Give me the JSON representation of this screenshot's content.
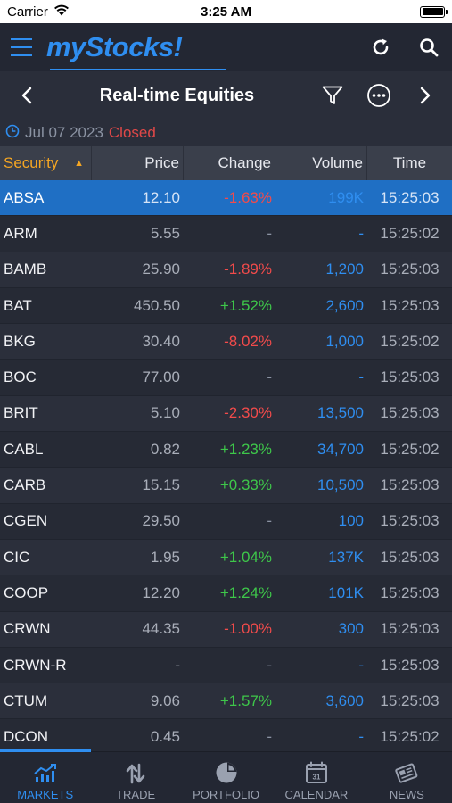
{
  "status": {
    "carrier": "Carrier",
    "time": "3:25 AM"
  },
  "app": {
    "logo": "myStocks!"
  },
  "header": {
    "title": "Real-time Equities"
  },
  "market": {
    "date": "Jul 07 2023",
    "state": "Closed"
  },
  "columns": {
    "security": "Security",
    "price": "Price",
    "change": "Change",
    "volume": "Volume",
    "time": "Time"
  },
  "rows": [
    {
      "security": "ABSA",
      "price": "12.10",
      "change": "-1.63%",
      "change_dir": "neg",
      "volume": "199K",
      "time": "15:25:03",
      "selected": true
    },
    {
      "security": "ARM",
      "price": "5.55",
      "change": "-",
      "change_dir": "nil",
      "volume": "-",
      "time": "15:25:02"
    },
    {
      "security": "BAMB",
      "price": "25.90",
      "change": "-1.89%",
      "change_dir": "neg",
      "volume": "1,200",
      "time": "15:25:03"
    },
    {
      "security": "BAT",
      "price": "450.50",
      "change": "+1.52%",
      "change_dir": "pos",
      "volume": "2,600",
      "time": "15:25:03"
    },
    {
      "security": "BKG",
      "price": "30.40",
      "change": "-8.02%",
      "change_dir": "neg",
      "volume": "1,000",
      "time": "15:25:02"
    },
    {
      "security": "BOC",
      "price": "77.00",
      "change": "-",
      "change_dir": "nil",
      "volume": "-",
      "time": "15:25:03"
    },
    {
      "security": "BRIT",
      "price": "5.10",
      "change": "-2.30%",
      "change_dir": "neg",
      "volume": "13,500",
      "time": "15:25:03"
    },
    {
      "security": "CABL",
      "price": "0.82",
      "change": "+1.23%",
      "change_dir": "pos",
      "volume": "34,700",
      "time": "15:25:02"
    },
    {
      "security": "CARB",
      "price": "15.15",
      "change": "+0.33%",
      "change_dir": "pos",
      "volume": "10,500",
      "time": "15:25:03"
    },
    {
      "security": "CGEN",
      "price": "29.50",
      "change": "-",
      "change_dir": "nil",
      "volume": "100",
      "time": "15:25:03"
    },
    {
      "security": "CIC",
      "price": "1.95",
      "change": "+1.04%",
      "change_dir": "pos",
      "volume": "137K",
      "time": "15:25:03"
    },
    {
      "security": "COOP",
      "price": "12.20",
      "change": "+1.24%",
      "change_dir": "pos",
      "volume": "101K",
      "time": "15:25:03"
    },
    {
      "security": "CRWN",
      "price": "44.35",
      "change": "-1.00%",
      "change_dir": "neg",
      "volume": "300",
      "time": "15:25:03"
    },
    {
      "security": "CRWN-R",
      "price": "-",
      "change": "-",
      "change_dir": "nil",
      "volume": "-",
      "time": "15:25:03"
    },
    {
      "security": "CTUM",
      "price": "9.06",
      "change": "+1.57%",
      "change_dir": "pos",
      "volume": "3,600",
      "time": "15:25:03"
    },
    {
      "security": "DCON",
      "price": "0.45",
      "change": "-",
      "change_dir": "nil",
      "volume": "-",
      "time": "15:25:02"
    }
  ],
  "tabs": [
    {
      "label": "MARKETS",
      "icon": "markets-chart-icon",
      "active": true
    },
    {
      "label": "TRADE",
      "icon": "trade-arrows-icon"
    },
    {
      "label": "PORTFOLIO",
      "icon": "portfolio-pie-icon"
    },
    {
      "label": "CALENDAR",
      "icon": "calendar-icon",
      "day": "31"
    },
    {
      "label": "NEWS",
      "icon": "news-icon"
    }
  ],
  "colors": {
    "accent": "#2f8ef0",
    "positive": "#3ec74a",
    "negative": "#f24b4b",
    "sort_header": "#f5a623",
    "selected_row": "#1f6fc4"
  }
}
